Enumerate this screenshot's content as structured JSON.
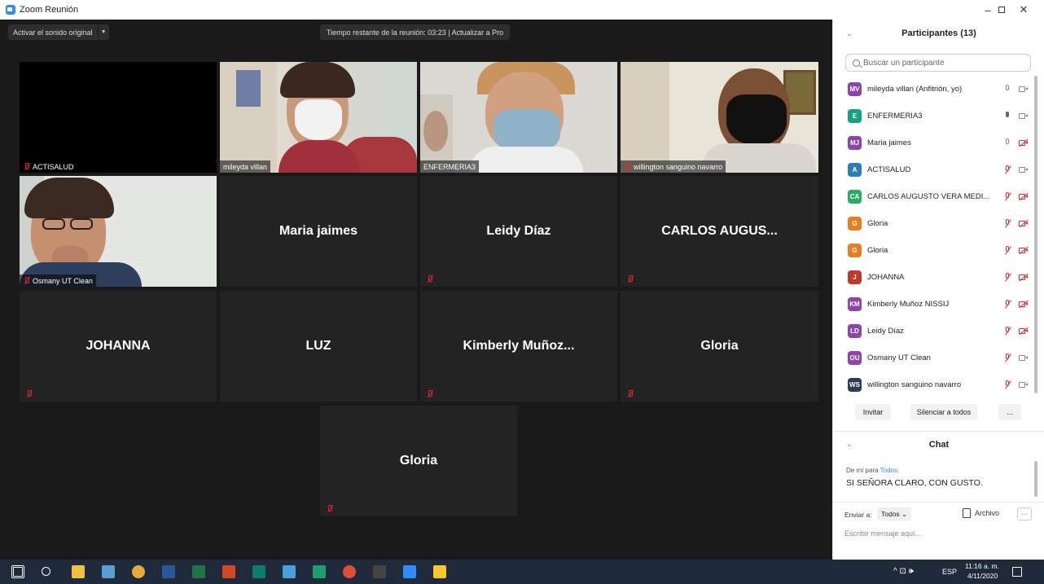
{
  "window": {
    "title": "Zoom Reunión",
    "controls": [
      "–",
      "▢",
      "✕"
    ]
  },
  "meeting": {
    "audio_button": "Activar el sonido original",
    "timer_text": "Tiempo restante de la reunión: 03:23 | Actualizar a Pro",
    "tiles": [
      {
        "name": "ACTISALUD",
        "video": true,
        "muted": true
      },
      {
        "name": "mileyda villan",
        "video": true,
        "muted": false
      },
      {
        "name": "ENFERMERIA3",
        "video": true,
        "muted": false,
        "active": true
      },
      {
        "name": "willington sanguino navarro",
        "video": true,
        "muted": true
      },
      {
        "name": "Osmany UT Clean",
        "video": true,
        "muted": true
      },
      {
        "name": "Maria jaimes",
        "video": false,
        "muted": false
      },
      {
        "name": "Leidy Díaz",
        "video": false,
        "muted": true
      },
      {
        "name": "CARLOS  AUGUS...",
        "video": false,
        "muted": true
      },
      {
        "name": "JOHANNA",
        "video": false,
        "muted": true
      },
      {
        "name": "LUZ",
        "video": false,
        "muted": false
      },
      {
        "name": "Kimberly  Muñoz...",
        "video": false,
        "muted": true
      },
      {
        "name": "Gloria",
        "video": false,
        "muted": true
      },
      {
        "name": "Gloria",
        "video": false,
        "muted": true
      }
    ]
  },
  "participants": {
    "header": "Participantes (13)",
    "search_placeholder": "Buscar un participante",
    "list": [
      {
        "initials": "MV",
        "name": "mileyda villan (Anfitrión, yo)",
        "color": "#8e44ad",
        "mic": "off",
        "cam": "on"
      },
      {
        "initials": "E",
        "name": "ENFERMERIA3",
        "color": "#16a085",
        "mic": "on",
        "cam": "on"
      },
      {
        "initials": "MJ",
        "name": "Maria jaimes",
        "color": "#8e44ad",
        "mic": "off",
        "cam": "muted"
      },
      {
        "initials": "A",
        "name": "ACTISALUD",
        "color": "#2980b9",
        "mic": "muted",
        "cam": "on"
      },
      {
        "initials": "CA",
        "name": "CARLOS AUGUSTO VERA MEDI...",
        "color": "#27ae60",
        "mic": "muted",
        "cam": "muted"
      },
      {
        "initials": "G",
        "name": "Gloria",
        "color": "#e67e22",
        "mic": "muted",
        "cam": "muted"
      },
      {
        "initials": "G",
        "name": "Gloria",
        "color": "#e67e22",
        "mic": "muted",
        "cam": "muted"
      },
      {
        "initials": "J",
        "name": "JOHANNA",
        "color": "#c0392b",
        "mic": "muted",
        "cam": "muted"
      },
      {
        "initials": "KM",
        "name": "Kimberly Muñoz NISSIJ",
        "color": "#8e44ad",
        "mic": "muted",
        "cam": "muted"
      },
      {
        "initials": "LD",
        "name": "Leidy Díaz",
        "color": "#8e44ad",
        "mic": "muted",
        "cam": "muted"
      },
      {
        "initials": "OU",
        "name": "Osmany UT Clean",
        "color": "#8e44ad",
        "mic": "muted",
        "cam": "on"
      },
      {
        "initials": "WS",
        "name": "willington sanguino navarro",
        "color": "#2c3e50",
        "mic": "muted",
        "cam": "on"
      }
    ],
    "buttons": {
      "invite": "Invitar",
      "mute_all": "Silenciar a todos",
      "more": "..."
    }
  },
  "chat": {
    "header": "Chat",
    "from_prefix": "De mí para ",
    "to": "Todos:",
    "message": "SI SEÑORA CLARO, CON GUSTO.",
    "send_to_label": "Enviar a:",
    "send_to_value": "Todos ⌄",
    "file_label": "Archivo",
    "more": "···",
    "input_placeholder": "Escribir mensaje aquí..."
  },
  "taskbar": {
    "lang": "ESP",
    "time": "11:16 a. m.",
    "date": "4/11/2020",
    "tray": "^ ⊡ 🕪",
    "icon_colors": [
      "#ffffff",
      "#4a9eda",
      "#f0c040",
      "#5a9fd4",
      "#e9a93a",
      "#2b579a",
      "#217346",
      "#d24726",
      "#0f7b6c",
      "#4a9eda",
      "#1e9e6e",
      "#e04e39",
      "#444444",
      "#2d8cff",
      "#f7c531"
    ]
  }
}
